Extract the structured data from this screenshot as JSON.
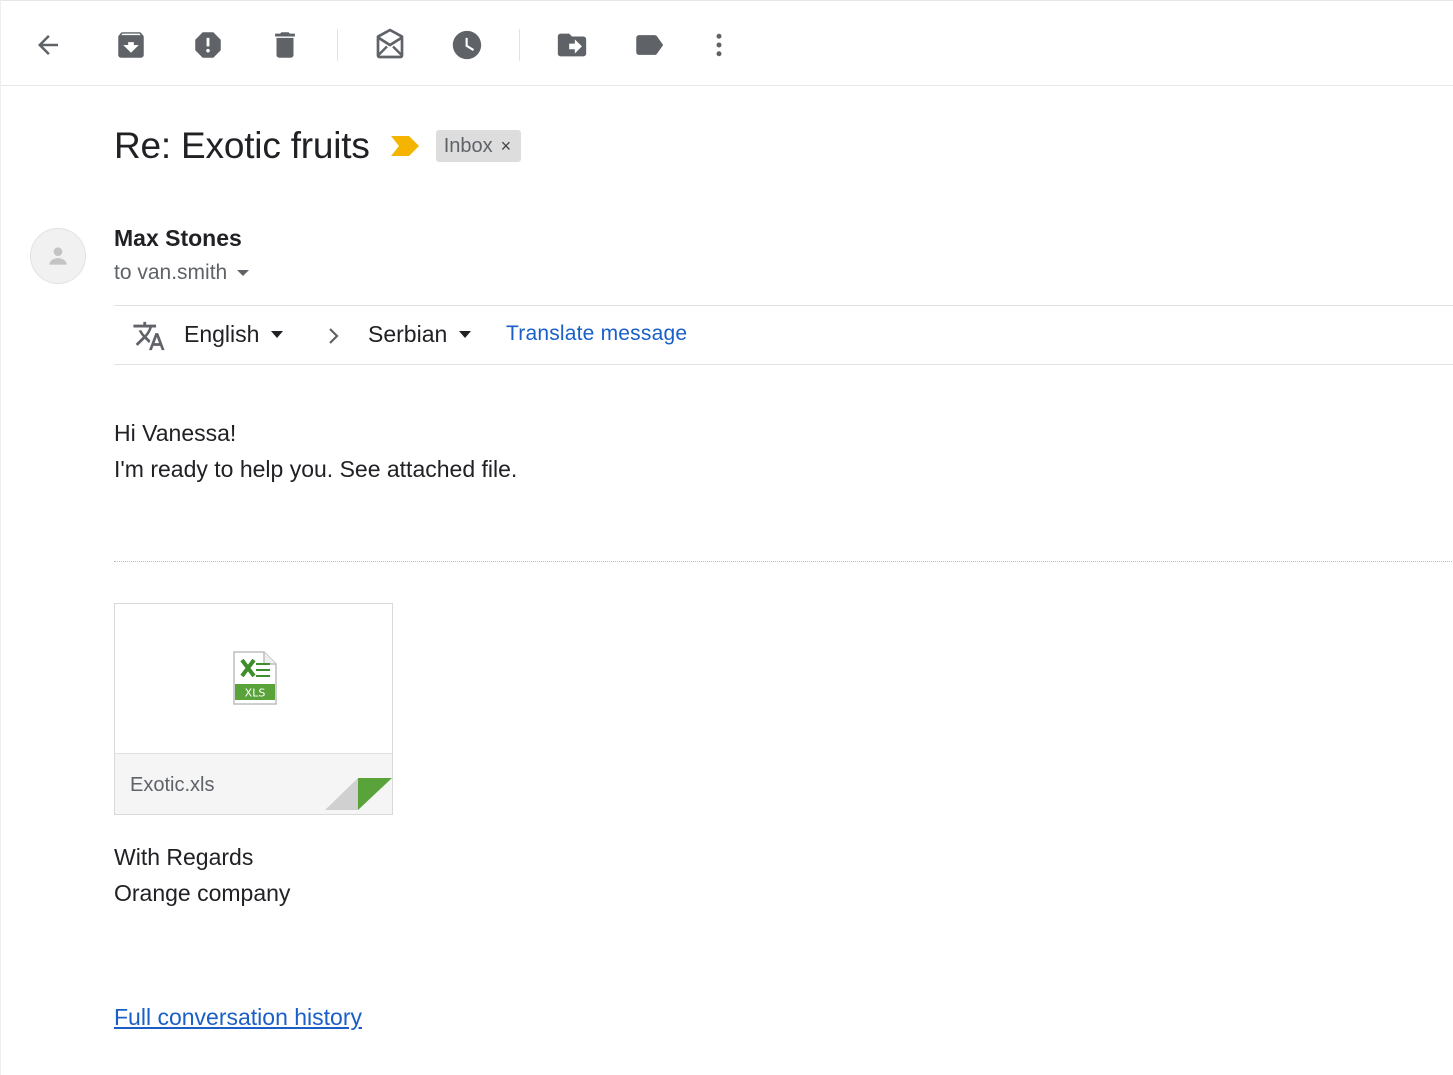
{
  "toolbar": {
    "buttons": [
      {
        "name": "back",
        "icon": "arrow-left-icon"
      },
      {
        "name": "archive",
        "icon": "archive-icon"
      },
      {
        "name": "report-spam",
        "icon": "report-spam-icon"
      },
      {
        "name": "delete",
        "icon": "trash-icon"
      },
      {
        "name": "mark-unread",
        "icon": "mark-unread-icon"
      },
      {
        "name": "snooze",
        "icon": "clock-icon"
      },
      {
        "name": "move-to",
        "icon": "move-to-icon"
      },
      {
        "name": "labels",
        "icon": "label-icon"
      },
      {
        "name": "more",
        "icon": "more-vertical-icon"
      }
    ]
  },
  "email": {
    "subject": "Re: Exotic fruits",
    "importance_color": "#f4b400",
    "label": "Inbox",
    "label_remove": "×",
    "sender": "Max Stones",
    "recipient": "to van.smith",
    "body_lines": [
      "Hi Vanessa!",
      "I'm ready to help you. See attached file."
    ],
    "signature_lines": [
      "With Regards",
      "Orange company"
    ],
    "history_link": "Full conversation history"
  },
  "translate": {
    "icon": "translate-icon",
    "from_language": "English",
    "to_language": "Serbian",
    "action": "Translate message"
  },
  "attachment": {
    "file_name": "Exotic.xls",
    "type_badge": "XLS",
    "icon": "excel-file-icon",
    "accent_color": "#5aa33a"
  },
  "colors": {
    "link": "#1a5fc8",
    "text": "#202124",
    "muted": "#5f6368"
  }
}
